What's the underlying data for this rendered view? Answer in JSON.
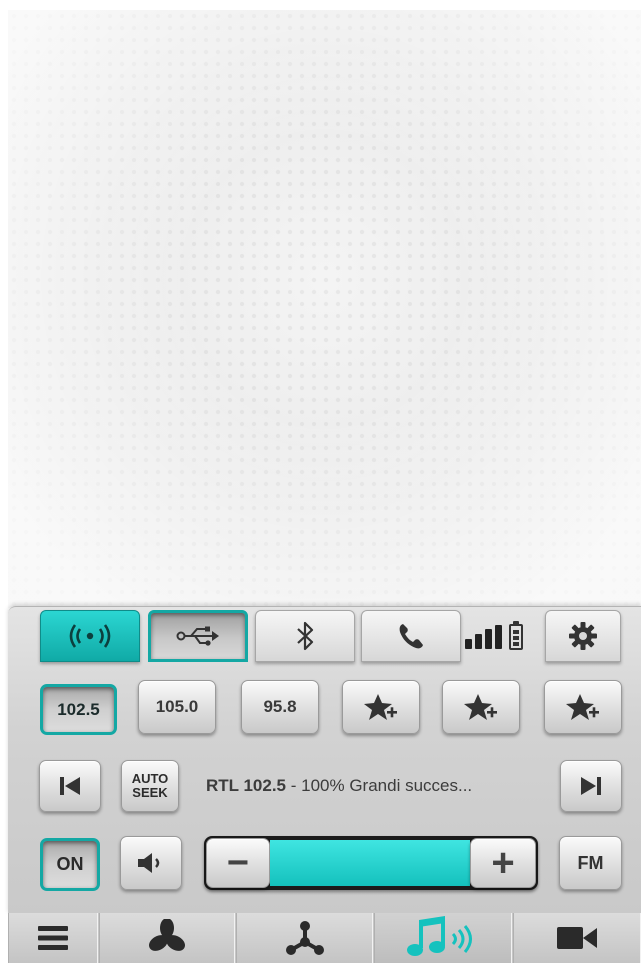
{
  "top_tabs": [
    {
      "id": "radio",
      "icon": "radio-waves-icon",
      "state": "active"
    },
    {
      "id": "usb",
      "icon": "usb-icon",
      "state": "pressed"
    },
    {
      "id": "bluetooth",
      "icon": "bluetooth-icon",
      "state": "normal"
    },
    {
      "id": "phone",
      "icon": "phone-icon",
      "state": "normal"
    }
  ],
  "status": {
    "signal_icon": "signal-bars-icon",
    "battery_icon": "battery-icon"
  },
  "settings_icon": "gear-icon",
  "presets": [
    {
      "label": "102.5",
      "selected": true
    },
    {
      "label": "105.0",
      "selected": false
    },
    {
      "label": "95.8",
      "selected": false
    }
  ],
  "favorite_icon": "star-add-icon",
  "playback": {
    "auto_seek_line1": "AUTO",
    "auto_seek_line2": "SEEK",
    "station_name": "RTL 102.5",
    "station_info": " - 100% Grandi succes..."
  },
  "controls": {
    "power_label": "ON",
    "band_label": "FM",
    "volume_level_fraction": 0.75,
    "minus_label": "−",
    "plus_label": "+"
  },
  "bottom_nav": [
    {
      "id": "menu",
      "icon": "hamburger-menu-icon"
    },
    {
      "id": "climate",
      "icon": "fan-icon"
    },
    {
      "id": "navigation",
      "icon": "nodes-icon"
    },
    {
      "id": "media",
      "icon": "music-notes-icon",
      "selected": true
    },
    {
      "id": "camera",
      "icon": "video-camera-icon"
    }
  ],
  "colors": {
    "accent": "#1fc6c2",
    "accent_dark": "#0f8784"
  }
}
